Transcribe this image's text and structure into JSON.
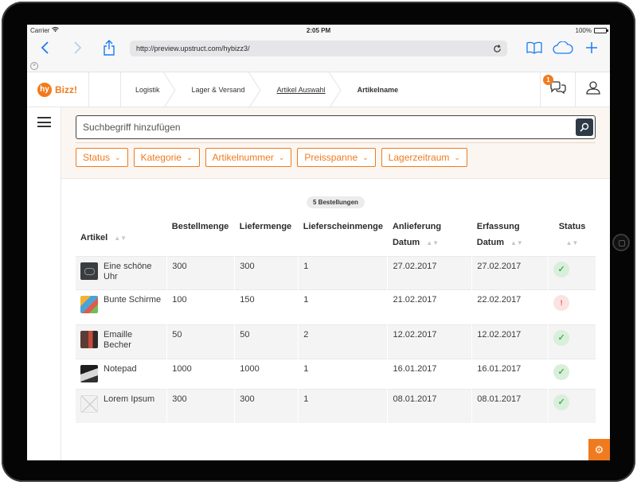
{
  "statusbar": {
    "carrier": "Carrier",
    "time": "2:05 PM",
    "battery": "100%"
  },
  "browser": {
    "url": "http://preview.upstruct.com/hybizz3/"
  },
  "app": {
    "logo_mark": "hy",
    "logo_text": "Bizz!",
    "notification_count": "1"
  },
  "breadcrumb": [
    "Logistik",
    "Lager & Versand",
    "Artikel Auswahl",
    "Artikelname"
  ],
  "search": {
    "placeholder": "Suchbegriff hinzufügen"
  },
  "filters": [
    "Status",
    "Kategorie",
    "Artikelnummer",
    "Preisspanne",
    "Lagerzeitraum"
  ],
  "results": {
    "count_label": "5 Bestellungen"
  },
  "table": {
    "columns": {
      "artikel": "Artikel",
      "bestellmenge": "Bestellmenge",
      "liefermenge": "Liefermenge",
      "lieferscheinmenge": "Lieferscheinmenge",
      "anlieferung_line1": "Anlieferung",
      "anlieferung_line2": "Datum",
      "erfassung_line1": "Erfassung",
      "erfassung_line2": "Datum",
      "status": "Status"
    },
    "rows": [
      {
        "name": "Eine schöne Uhr",
        "bestellmenge": "300",
        "liefermenge": "300",
        "lieferscheinmenge": "1",
        "anlieferung": "27.02.2017",
        "erfassung": "27.02.2017",
        "status": "ok"
      },
      {
        "name": "Bunte Schirme",
        "bestellmenge": "100",
        "liefermenge": "150",
        "lieferscheinmenge": "1",
        "anlieferung": "21.02.2017",
        "erfassung": "22.02.2017",
        "status": "warning"
      },
      {
        "name": "Emaille Becher",
        "bestellmenge": "50",
        "liefermenge": "50",
        "lieferscheinmenge": "2",
        "anlieferung": "12.02.2017",
        "erfassung": "12.02.2017",
        "status": "ok"
      },
      {
        "name": "Notepad",
        "bestellmenge": "1000",
        "liefermenge": "1000",
        "lieferscheinmenge": "1",
        "anlieferung": "16.01.2017",
        "erfassung": "16.01.2017",
        "status": "ok"
      },
      {
        "name": "Lorem Ipsum",
        "bestellmenge": "300",
        "liefermenge": "300",
        "lieferscheinmenge": "1",
        "anlieferung": "08.01.2017",
        "erfassung": "08.01.2017",
        "status": "ok"
      }
    ]
  },
  "colors": {
    "accent": "#f07b1f",
    "ok": "#4caf50",
    "warning": "#e35b4a"
  }
}
